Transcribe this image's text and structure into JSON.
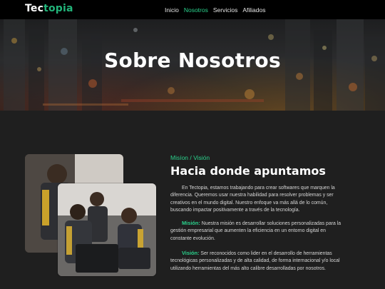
{
  "brand": {
    "part1": "Tec",
    "part2": "topia"
  },
  "nav": {
    "items": [
      "Inicio",
      "Nosotros",
      "Servicios",
      "Afiliados"
    ],
    "active": "Nosotros"
  },
  "hero": {
    "title": "Sobre Nosotros"
  },
  "about": {
    "eyebrow": "Misíon / Visión",
    "title": "Hacia donde apuntamos",
    "intro": "En Tectopia, estamos trabajando para crear softwares que marquen la diferencia. Queremos usar nuestra habilidad para resolver problemas y ser creativos en el mundo digital. Nuestro enfoque va más allá de lo común, buscando impactar positivamente a través de la tecnología.",
    "mission_label": "Misión:",
    "mission_text": " Nuestra misión es desarrollar soluciones personalizadas para la gestión empresarial que aumenten la eficiencia en un entorno digital en constante evolución.",
    "vision_label": "Visión:",
    "vision_text": " Ser reconocidos como lider en el desarrollo de herramientas tecnológicas personalizadas y de alta calidad, de forma internacional y/o local utilizando herramientas del más alto calibre desarrolladas por nosotros."
  },
  "colors": {
    "accent": "#2bd28d",
    "navbar": "#000000",
    "background": "#1f1f1f"
  }
}
